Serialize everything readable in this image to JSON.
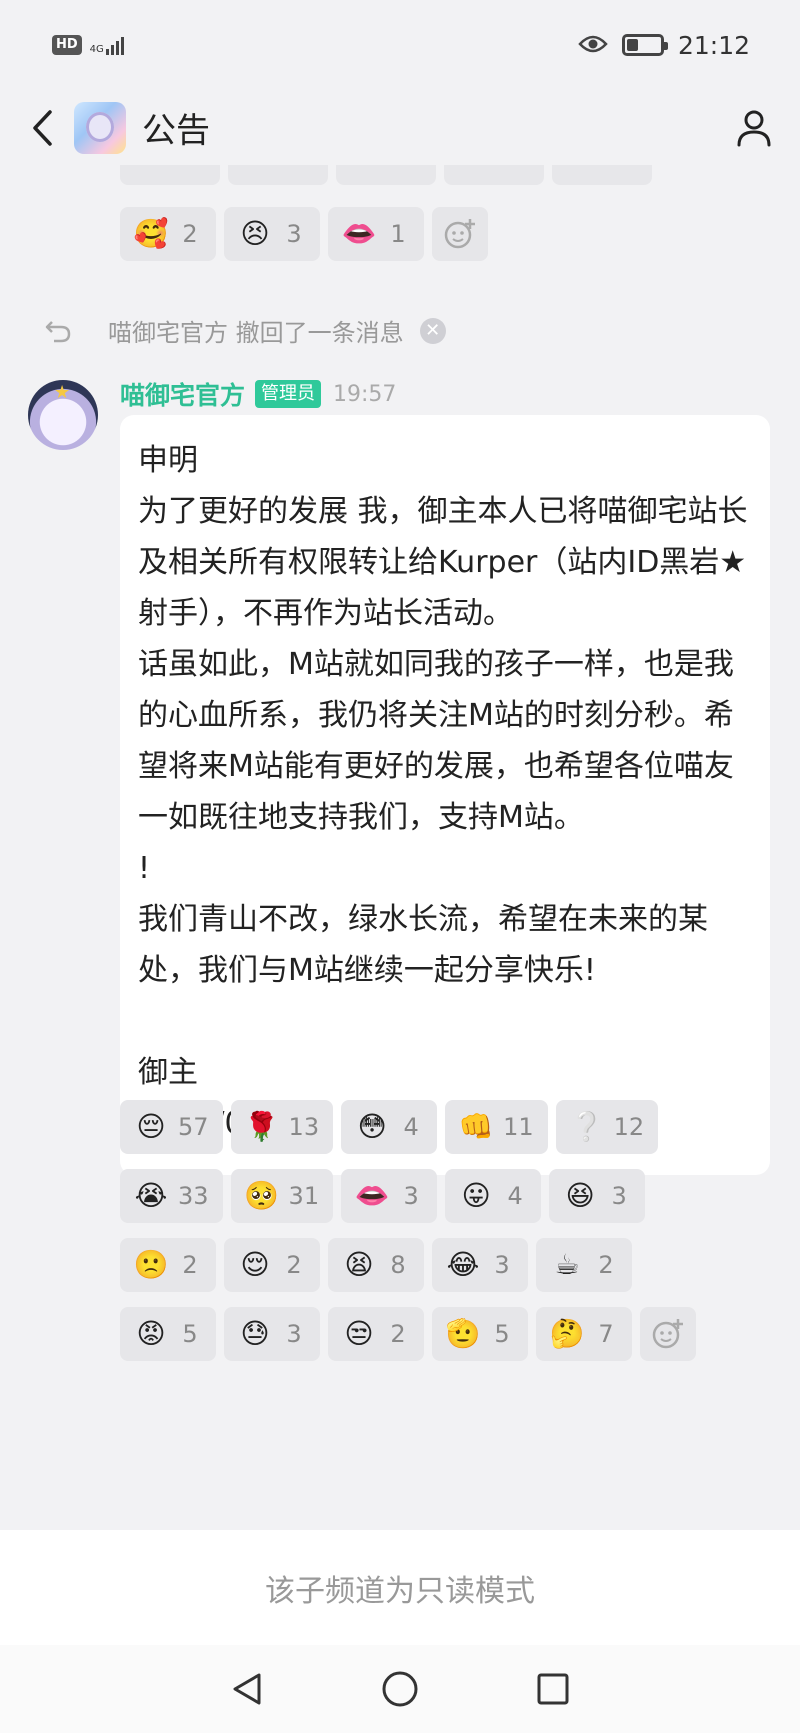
{
  "status_bar": {
    "hd": "HD",
    "network": "4G",
    "time": "21:12",
    "icons": [
      "signal-icon",
      "eye-icon",
      "battery-icon"
    ]
  },
  "header": {
    "title": "公告",
    "back_icon": "chevron-left-icon",
    "profile_icon": "person-icon"
  },
  "top_reactions": [
    {
      "emoji": "🥰",
      "count": "2"
    },
    {
      "emoji": "😣",
      "count": "3"
    },
    {
      "emoji": "👄",
      "count": "1"
    }
  ],
  "recall_notice": {
    "text": "喵御宅官方 撤回了一条消息",
    "close": "✕"
  },
  "message": {
    "sender": "喵御宅官方",
    "badge": "管理员",
    "time": "19:57",
    "body": "申明\n为了更好的发展 我，御主本人已将喵御宅站长及相关所有权限转让给Kurper（站内ID黑岩★射手），不再作为站长活动。\n话虽如此，M站就如同我的孩子一样，也是我的心血所系，我仍将关注M站的时刻分秒。希望将来M站能有更好的发展，也希望各位喵友一如既往地支持我们，支持M站。\n!\n我们青山不改，绿水长流，希望在未来的某处，我们与M站继续一起分享快乐!\n\n御主\n2022/08/07"
  },
  "reaction_rows": [
    [
      {
        "emoji": "😔",
        "count": "57"
      },
      {
        "emoji": "🌹",
        "count": "13"
      },
      {
        "emoji": "😳",
        "count": "4"
      },
      {
        "emoji": "👊",
        "count": "11"
      },
      {
        "emoji": "❔",
        "count": "12"
      }
    ],
    [
      {
        "emoji": "😭",
        "count": "33"
      },
      {
        "emoji": "🥺",
        "count": "31"
      },
      {
        "emoji": "👄",
        "count": "3"
      },
      {
        "emoji": "😛",
        "count": "4"
      },
      {
        "emoji": "😆",
        "count": "3"
      }
    ],
    [
      {
        "emoji": "🙁",
        "count": "2"
      },
      {
        "emoji": "😌",
        "count": "2"
      },
      {
        "emoji": "😫",
        "count": "8"
      },
      {
        "emoji": "😂",
        "count": "3"
      },
      {
        "emoji": "☕",
        "count": "2"
      }
    ],
    [
      {
        "emoji": "😡",
        "count": "5"
      },
      {
        "emoji": "😓",
        "count": "3"
      },
      {
        "emoji": "😒",
        "count": "2"
      },
      {
        "emoji": "🫡",
        "count": "5"
      },
      {
        "emoji": "🤔",
        "count": "7"
      }
    ]
  ],
  "footer": {
    "readonly_text": "该子频道为只读模式"
  },
  "nav": {
    "icons": [
      "back-triangle-icon",
      "home-circle-icon",
      "recents-square-icon"
    ]
  },
  "colors": {
    "accent": "#2fbf94",
    "badge": "#2fc99a",
    "background": "#f2f2f4",
    "bubble": "#ffffff"
  }
}
